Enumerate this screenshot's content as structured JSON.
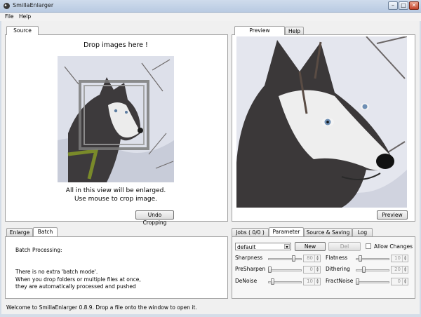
{
  "window": {
    "title": "SmillaEnlarger",
    "min": "–",
    "max": "□",
    "close": "✕"
  },
  "menu": {
    "file": "File",
    "help": "Help"
  },
  "source": {
    "tab": "Source",
    "drop_hint": "Drop images here !",
    "info_line1": "All in this view will be enlarged.",
    "info_line2": "Use mouse to crop image.",
    "undo_cropping": "Undo Cropping"
  },
  "preview": {
    "tab_preview": "Preview",
    "tab_help": "Help",
    "button": "Preview"
  },
  "bottom_left": {
    "tab_enlarge": "Enlarge",
    "tab_batch": "Batch",
    "title": "Batch Processing:",
    "line1": "There is no extra 'batch mode'.",
    "line2": "When you drop folders or multiple files at once,",
    "line3": "they are automatically processed and pushed"
  },
  "bottom_right": {
    "tabs": [
      "Jobs ( 0/0 )",
      "Parameter",
      "Source & Saving",
      "Log"
    ],
    "preset": "default",
    "new_button": "New",
    "del_button": "Del",
    "allow_changes": "Allow Changes",
    "params": {
      "sharpness": {
        "label": "Sharpness",
        "value": "80",
        "level": 0.8
      },
      "flatness": {
        "label": "Flatness",
        "value": "10",
        "level": 0.1
      },
      "presharpen": {
        "label": "PreSharpen",
        "value": "0",
        "level": 0.0
      },
      "dithering": {
        "label": "Dithering",
        "value": "20",
        "level": 0.2
      },
      "denoise": {
        "label": "DeNoise",
        "value": "10",
        "level": 0.1
      },
      "fractnoise": {
        "label": "FractNoise",
        "value": "0",
        "level": 0.0
      }
    }
  },
  "status": "Welcome to SmillaEnlarger 0.8.9.  Drop a file onto the window to open it."
}
